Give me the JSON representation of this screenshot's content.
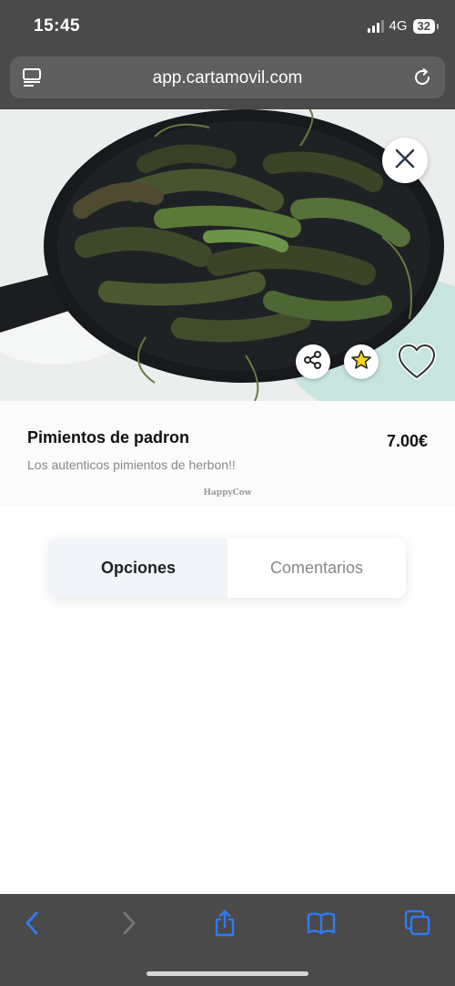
{
  "status_bar": {
    "time": "15:45",
    "network": "4G",
    "battery": "32"
  },
  "browser": {
    "url": "app.cartamovil.com",
    "reader_icon": "reader-icon",
    "reload_icon": "reload-icon"
  },
  "product": {
    "name": "Pimientos de padron",
    "price": "7.00€",
    "description": "Los autenticos pimientos de herbon!!",
    "watermark": "HappyCow",
    "image": "fried green padron peppers in black pan"
  },
  "actions": {
    "close_icon": "close-icon",
    "share_icon": "share-icon",
    "favorite_icon": "star-icon",
    "like_icon": "heart-icon"
  },
  "tabs": [
    {
      "label": "Opciones",
      "active": true
    },
    {
      "label": "Comentarios",
      "active": false
    }
  ],
  "toolbar": {
    "items": [
      "back-icon",
      "forward-icon",
      "share-icon",
      "bookmarks-icon",
      "tabs-icon"
    ]
  },
  "colors": {
    "accent": "#2f7bf5",
    "star": "#f7d31e",
    "browser_chrome": "#4a4a4a"
  }
}
